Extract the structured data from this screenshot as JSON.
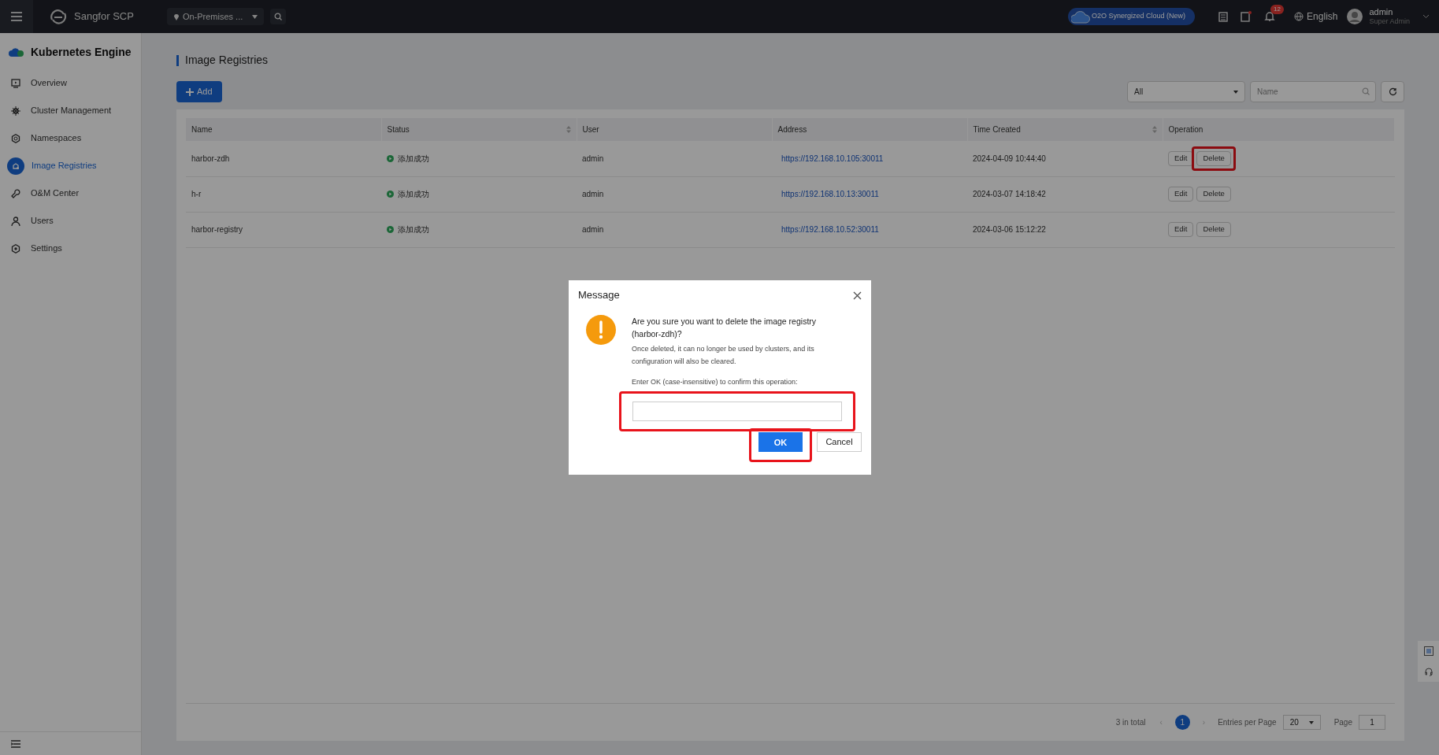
{
  "topbar": {
    "brand": "Sangfor SCP",
    "location": "On-Premises ...",
    "cloud_badge": "O2O Synergized Cloud (New)",
    "notifications": "12",
    "language": "English",
    "user": "admin",
    "role": "Super Admin"
  },
  "sidebar": {
    "title": "Kubernetes Engine",
    "items": [
      {
        "label": "Overview",
        "selected": false
      },
      {
        "label": "Cluster Management",
        "selected": false
      },
      {
        "label": "Namespaces",
        "selected": false
      },
      {
        "label": "Image Registries",
        "selected": true
      },
      {
        "label": "O&M Center",
        "selected": false
      },
      {
        "label": "Users",
        "selected": false
      },
      {
        "label": "Settings",
        "selected": false
      }
    ]
  },
  "page": {
    "title": "Image Registries",
    "add_button": "Add",
    "filter": "All",
    "search": {
      "placeholder": "Name"
    }
  },
  "table": {
    "columns": [
      {
        "label": "Name",
        "kind": "plain"
      },
      {
        "label": "Status",
        "kind": "sortable"
      },
      {
        "label": "User",
        "kind": "plain"
      },
      {
        "label": "Address",
        "kind": "plain"
      },
      {
        "label": "Time Created",
        "kind": "sortable"
      },
      {
        "label": "Operation",
        "kind": "plain"
      }
    ],
    "rows": [
      {
        "name": "harbor-zdh",
        "status": "添加成功",
        "user": "admin",
        "address": "https://192.168.10.105:30011",
        "time": "2024-04-09 10:44:40",
        "actions": [
          "Edit",
          "Delete"
        ],
        "delete_highlighted": true
      },
      {
        "name": "h-r",
        "status": "添加成功",
        "user": "admin",
        "address": "https://192.168.10.13:30011",
        "time": "2024-03-07 14:18:42",
        "actions": [
          "Edit",
          "Delete"
        ],
        "delete_highlighted": false
      },
      {
        "name": "harbor-registry",
        "status": "添加成功",
        "user": "admin",
        "address": "https://192.168.10.52:30011",
        "time": "2024-03-06 15:12:22",
        "actions": [
          "Edit",
          "Delete"
        ],
        "delete_highlighted": false
      }
    ]
  },
  "pagination": {
    "total": "3 in total",
    "previous": "‹",
    "current_page": "1",
    "next": "›",
    "entries_label": "Entries per Page",
    "entries": "20",
    "page_label": "Page",
    "page": "1"
  },
  "dialog": {
    "title": "Message",
    "question": "Are you sure you want to delete the image registry (harbor-zdh)?",
    "detail": "Once deleted, it can no longer be used by clusters, and its configuration will also be cleared.",
    "prompt": "Enter OK (case-insensitive) to confirm this operation:",
    "field_highlighted": true,
    "buttons": [
      {
        "label": "OK",
        "kind": "primary",
        "highlighted": true
      },
      {
        "label": "Cancel",
        "kind": "secondary",
        "highlighted": false
      }
    ]
  }
}
